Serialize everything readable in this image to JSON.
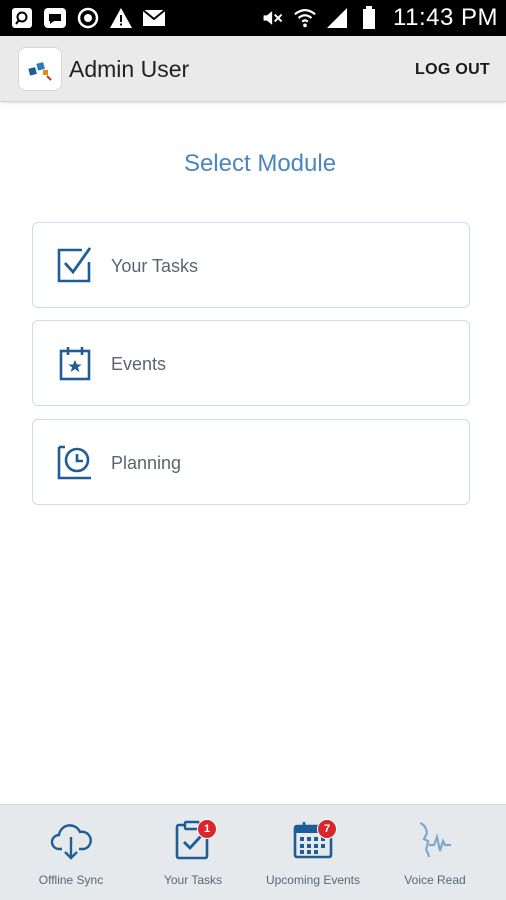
{
  "status_bar": {
    "time": "11:43 PM",
    "left_icons": [
      "search-notification-icon",
      "chat-notification-icon",
      "sync-notification-icon",
      "warning-icon",
      "mail-icon"
    ],
    "right_icons": [
      "mute-icon",
      "wifi-icon",
      "signal-icon",
      "battery-icon"
    ]
  },
  "app_bar": {
    "title": "Admin User",
    "logout_label": "LOG OUT"
  },
  "main": {
    "heading": "Select Module",
    "modules": [
      {
        "label": "Your Tasks",
        "icon": "checkbox-icon"
      },
      {
        "label": "Events",
        "icon": "calendar-star-icon"
      },
      {
        "label": "Planning",
        "icon": "clock-board-icon"
      }
    ]
  },
  "bottom_nav": {
    "items": [
      {
        "label": "Offline Sync",
        "icon": "cloud-download-icon"
      },
      {
        "label": "Your Tasks",
        "icon": "clipboard-check-icon",
        "badge": "1"
      },
      {
        "label": "Upcoming Events",
        "icon": "calendar-icon",
        "badge": "7"
      },
      {
        "label": "Voice Read",
        "icon": "voice-wave-icon"
      }
    ]
  },
  "colors": {
    "accent": "#4a86c0",
    "icon_blue": "#1f5d96",
    "badge_red": "#d9262b",
    "status_bar": "#000000",
    "app_bar": "#eaeaea"
  }
}
